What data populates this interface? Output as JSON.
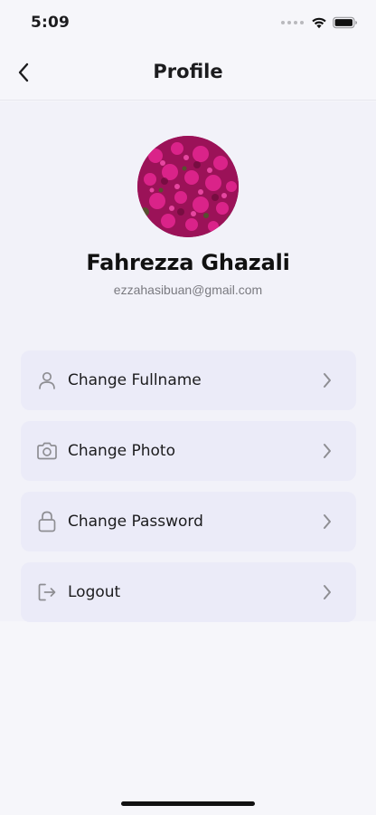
{
  "status_bar": {
    "time": "5:09",
    "icons": [
      "signal-dots-icon",
      "wifi-icon",
      "battery-icon"
    ]
  },
  "nav": {
    "title": "Profile",
    "back_icon": "chevron-left-icon"
  },
  "profile": {
    "name": "Fahrezza Ghazali",
    "email": "ezzahasibuan@gmail.com",
    "avatar": "flower-photo"
  },
  "menu": {
    "items": [
      {
        "label": "Change Fullname",
        "icon": "user-icon"
      },
      {
        "label": "Change Photo",
        "icon": "camera-icon"
      },
      {
        "label": "Change Password",
        "icon": "lock-icon"
      },
      {
        "label": "Logout",
        "icon": "logout-icon"
      }
    ],
    "chevron_icon": "chevron-right-icon"
  },
  "colors": {
    "background": "#f6f6fa",
    "content_background": "#f2f2f9",
    "menu_item_background": "#ebebf8",
    "icon_gray": "#8e8e93",
    "text": "#1c1c1e",
    "email_gray": "#7a7a80"
  }
}
